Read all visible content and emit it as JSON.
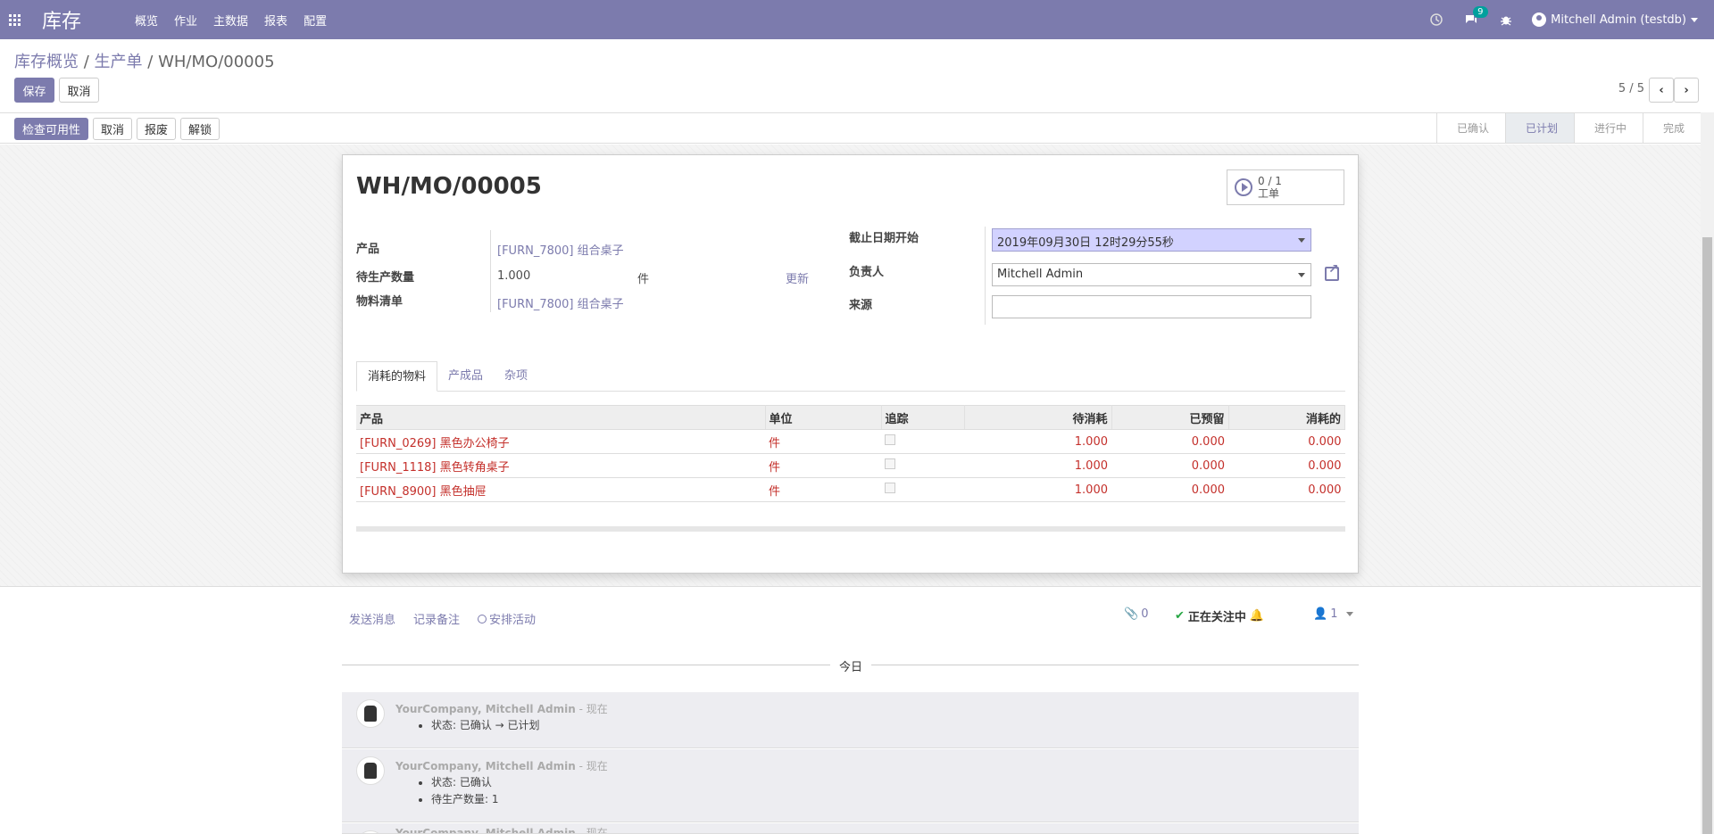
{
  "navbar": {
    "app_title": "库存",
    "menu": [
      "概览",
      "作业",
      "主数据",
      "报表",
      "配置"
    ],
    "chat_count": "9",
    "user": "Mitchell Admin (testdb)"
  },
  "breadcrumb": {
    "first": "库存概览",
    "second": "生产单",
    "current": "WH/MO/00005",
    "sep": "/"
  },
  "control": {
    "save": "保存",
    "discard": "取消",
    "pager": "5 / 5"
  },
  "statusbar": {
    "buttons": [
      "检查可用性",
      "取消",
      "报废",
      "解锁"
    ],
    "stages": [
      "已确认",
      "已计划",
      "进行中",
      "完成"
    ],
    "active_stage": "已计划"
  },
  "form": {
    "title": "WH/MO/00005",
    "smart_button": {
      "count": "0 / 1",
      "label": "工单"
    },
    "product_label": "产品",
    "product_value": "[FURN_7800] 组合桌子",
    "qty_label": "待生产数量",
    "qty_value": "1.000",
    "uom": "件",
    "update": "更新",
    "bom_label": "物料清单",
    "bom_value": "[FURN_7800] 组合桌子",
    "deadline_label": "截止日期开始",
    "deadline_value": "2019年09月30日 12时29分55秒",
    "responsible_label": "负责人",
    "responsible_value": "Mitchell Admin",
    "source_label": "来源",
    "source_value": ""
  },
  "tabs": [
    "消耗的物料",
    "产成品",
    "杂项"
  ],
  "table": {
    "headers": [
      "产品",
      "单位",
      "追踪",
      "待消耗",
      "已预留",
      "消耗的"
    ],
    "rows": [
      {
        "product": "[FURN_0269] 黑色办公椅子",
        "unit": "件",
        "to_consume": "1.000",
        "reserved": "0.000",
        "consumed": "0.000"
      },
      {
        "product": "[FURN_1118] 黑色转角桌子",
        "unit": "件",
        "to_consume": "1.000",
        "reserved": "0.000",
        "consumed": "0.000"
      },
      {
        "product": "[FURN_8900] 黑色抽屉",
        "unit": "件",
        "to_consume": "1.000",
        "reserved": "0.000",
        "consumed": "0.000"
      }
    ]
  },
  "chatter": {
    "send_message": "发送消息",
    "log_note": "记录备注",
    "schedule": "安排活动",
    "attachments": "0",
    "following": "正在关注中",
    "followers": "1",
    "today": "今日",
    "messages": [
      {
        "author": "YourCompany, Mitchell Admin",
        "time": "- 现在",
        "lines": [
          "状态: 已确认 → 已计划"
        ]
      },
      {
        "author": "YourCompany, Mitchell Admin",
        "time": "- 现在",
        "lines": [
          "状态: 已确认",
          "待生产数量: 1"
        ]
      },
      {
        "author": "YourCompany, Mitchell Admin",
        "time": "- 现在",
        "lines": []
      }
    ]
  }
}
